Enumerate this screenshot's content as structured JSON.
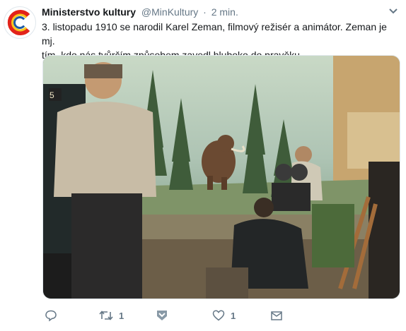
{
  "tweet": {
    "author_name": "Ministerstvo kultury",
    "handle": "@MinKultury",
    "separator": "·",
    "time": "2 min.",
    "text_line1": "3. listopadu 1910 se narodil Karel Zeman, filmový režisér a animátor. Zeman je mj.",
    "text_line2": "tím, kdo nás tvůrčím způsobem zavedl hluboko do pravěku.",
    "media_text": "5"
  },
  "actions": {
    "reply_icon": "reply-icon",
    "retweet_icon": "retweet-icon",
    "retweet_count": "1",
    "like_icon": "heart-icon",
    "like_count": "1",
    "message_icon": "direct-message-icon",
    "cards_icon": "chevron-heart-shield-icon"
  },
  "colors": {
    "text": "#14171a",
    "secondary": "#657786",
    "border": "#e1e8ed",
    "logo_red": "#e2231a",
    "logo_yellow": "#f7c51e",
    "logo_blue": "#1d5aa6"
  }
}
